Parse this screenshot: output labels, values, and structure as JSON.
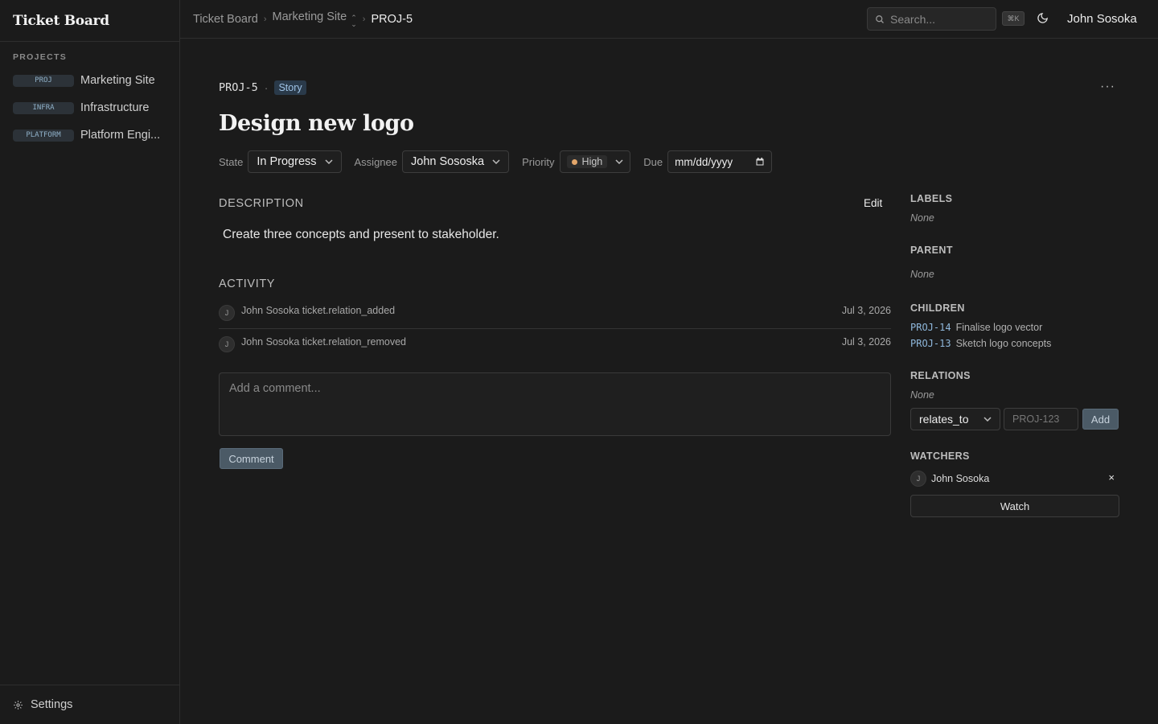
{
  "app": {
    "title": "Ticket Board"
  },
  "sidebar": {
    "section_title": "PROJECTS",
    "projects": [
      {
        "key": "PROJ",
        "name": "Marketing Site"
      },
      {
        "key": "INFRA",
        "name": "Infrastructure"
      },
      {
        "key": "PLATFORM",
        "name": "Platform Engi..."
      }
    ],
    "settings_label": "Settings"
  },
  "header": {
    "breadcrumbs": [
      "Ticket Board",
      "Marketing Site",
      "PROJ-5"
    ],
    "search_placeholder": "Search...",
    "shortcut": "⌘K",
    "user_name": "John Sosoka"
  },
  "ticket": {
    "id": "PROJ-5",
    "separator": "·",
    "type": "Story",
    "title": "Design new logo",
    "more_label": "···",
    "fields": {
      "state_label": "State",
      "state_value": "In Progress",
      "assignee_label": "Assignee",
      "assignee_value": "John Sososka",
      "priority_label": "Priority",
      "priority_value": "High",
      "due_label": "Due",
      "due_placeholder": "mm/dd/yyyy"
    },
    "description": {
      "heading": "DESCRIPTION",
      "edit_label": "Edit",
      "text": "Create three concepts and present to stakeholder."
    },
    "activity": {
      "heading": "ACTIVITY",
      "items": [
        {
          "avatar": "J",
          "text": "John Sosoka ticket.relation_added",
          "date": "Jul 3, 2026"
        },
        {
          "avatar": "J",
          "text": "John Sosoka ticket.relation_removed",
          "date": "Jul 3, 2026"
        }
      ]
    },
    "comment": {
      "placeholder": "Add a comment...",
      "button_label": "Comment"
    }
  },
  "details": {
    "labels_heading": "LABELS",
    "labels_value": "None",
    "parent_heading": "PARENT",
    "parent_value": "None",
    "children_heading": "CHILDREN",
    "children": [
      {
        "key": "PROJ-14",
        "title": "Finalise logo vector"
      },
      {
        "key": "PROJ-13",
        "title": "Sketch logo concepts"
      }
    ],
    "relations_heading": "RELATIONS",
    "relations_value": "None",
    "relation_type": "relates_to",
    "relation_placeholder": "PROJ-123",
    "add_label": "Add",
    "watchers_heading": "WATCHERS",
    "watcher": {
      "avatar": "J",
      "name": "John Sosoka"
    },
    "remove_label": "×",
    "watch_label": "Watch"
  },
  "colors": {
    "background": "#1b1b1b",
    "accent": "#4b5a66",
    "priority_high": "#e3a66a",
    "link": "#8fb8dc"
  }
}
